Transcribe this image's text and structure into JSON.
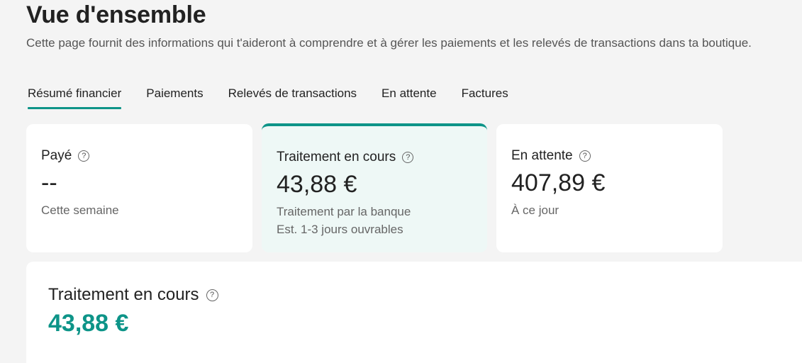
{
  "header": {
    "title": "Vue d'ensemble",
    "subtitle": "Cette page fournit des informations qui t'aideront à comprendre et à gérer les paiements et les relevés de transactions dans ta boutique."
  },
  "tabs": [
    {
      "label": "Résumé financier",
      "active": true
    },
    {
      "label": "Paiements",
      "active": false
    },
    {
      "label": "Relevés de transactions",
      "active": false
    },
    {
      "label": "En attente",
      "active": false
    },
    {
      "label": "Factures",
      "active": false
    }
  ],
  "cards": [
    {
      "title": "Payé",
      "amount": "--",
      "sub1": "Cette semaine",
      "sub2": "",
      "selected": false
    },
    {
      "title": "Traitement en cours",
      "amount": "43,88 €",
      "sub1": "Traitement par la banque",
      "sub2": "Est. 1-3 jours ouvrables",
      "selected": true
    },
    {
      "title": "En attente",
      "amount": "407,89 €",
      "sub1": "À ce jour",
      "sub2": "",
      "selected": false
    }
  ],
  "detail": {
    "title": "Traitement en cours",
    "amount": "43,88 €"
  },
  "icons": {
    "help": "question-circle-icon"
  },
  "colors": {
    "accent": "#0d9488",
    "selected_card_bg": "#eef8f6"
  }
}
